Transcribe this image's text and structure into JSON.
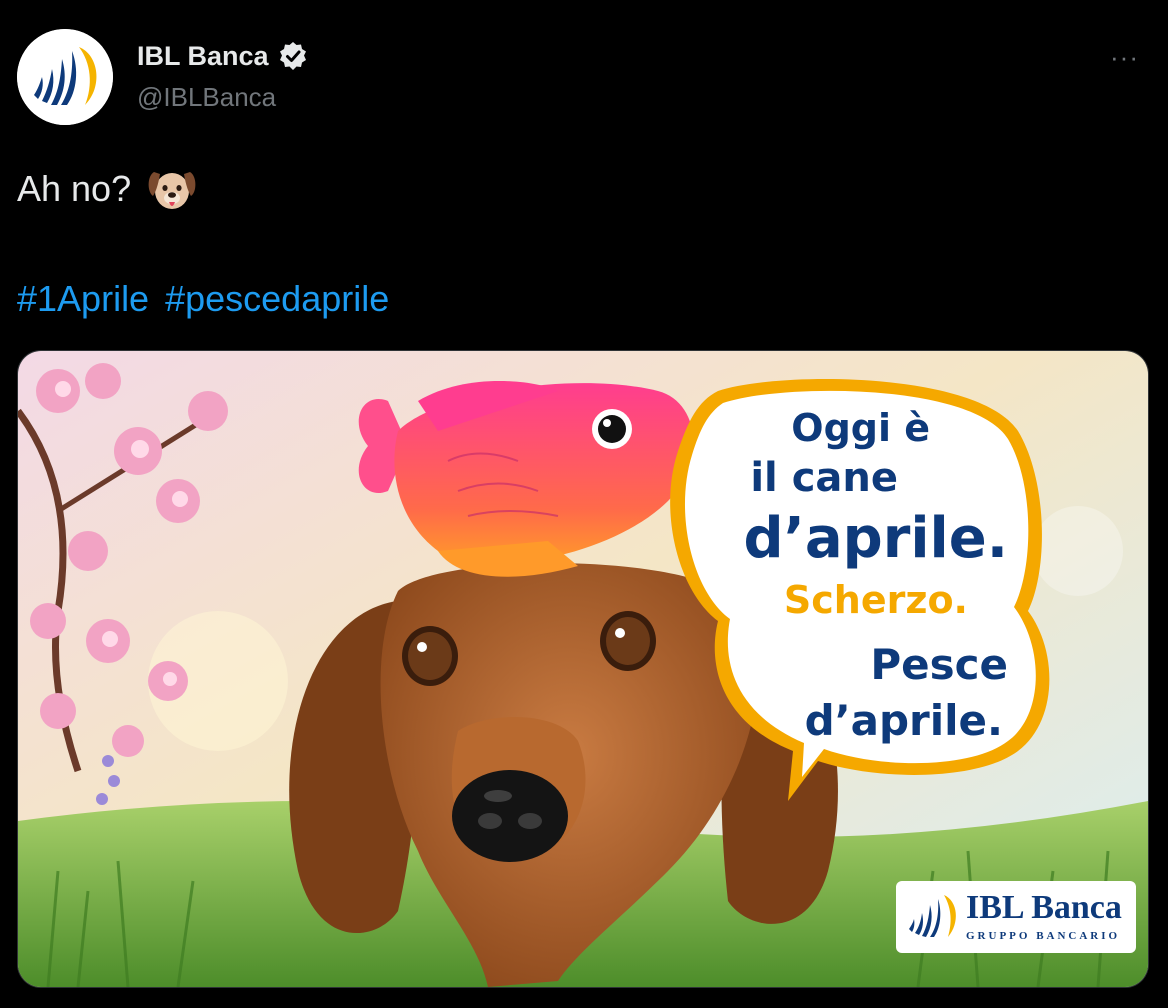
{
  "tweet": {
    "author_name": "IBL Banca",
    "author_handle": "@IBLBanca",
    "verified_icon": "verified-badge-icon",
    "more_label": "···",
    "text": "Ah no?",
    "emoji": "dog-face-emoji",
    "hashtags": [
      "#1Aprile",
      "#pescedaprile"
    ]
  },
  "media": {
    "bubble_line1": "Oggi è",
    "bubble_line2": "il cane",
    "bubble_line3": "d’aprile.",
    "bubble_line4": "Scherzo.",
    "bubble_line5": "Pesce",
    "bubble_line6": "d’aprile.",
    "logo_name": "IBL Banca",
    "logo_sub": "GRUPPO BANCARIO",
    "colors": {
      "navy": "#0e3a7b",
      "accent": "#f5a800",
      "link": "#1d9bf0"
    }
  }
}
